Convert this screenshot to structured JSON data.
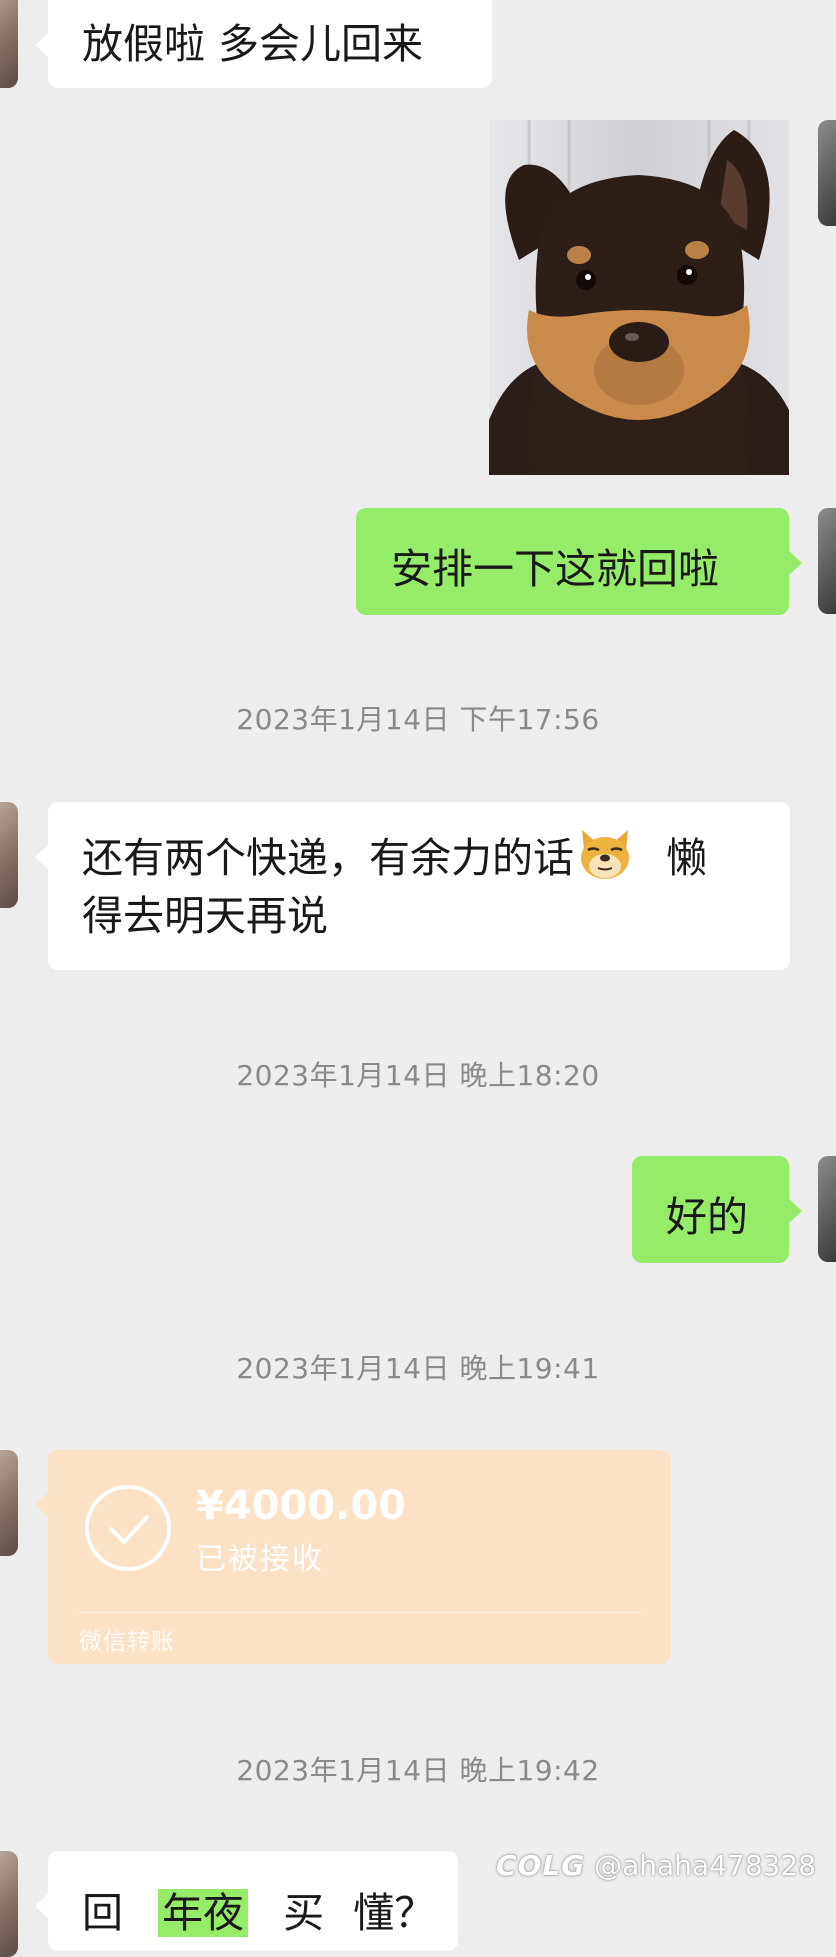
{
  "messages": {
    "m1": {
      "text": "放假啦 多会儿回来"
    },
    "m2": {
      "image": "dog-photo"
    },
    "m3": {
      "text": "安排一下这就回啦"
    },
    "ts1": "2023年1月14日 下午17:56",
    "m4": {
      "text_part1": "还有两个快递，有余力的话",
      "emoji": "doge-emoji",
      "text_part2": "懒",
      "text_line2": "得去明天再说"
    },
    "ts2": "2023年1月14日 晚上18:20",
    "m5": {
      "text": "好的"
    },
    "ts3": "2023年1月14日 晚上19:41",
    "transfer": {
      "amount": "¥4000.00",
      "status": "已被接收",
      "label": "微信转账"
    },
    "ts4": "2023年1月14日 晚上19:42",
    "m6": {
      "part1": "回",
      "highlight": "年夜",
      "part2": "买",
      "part3": "懂？"
    }
  },
  "watermark": {
    "logo": "COLG",
    "handle": "@ahaha478328"
  },
  "colors": {
    "background": "#ededed",
    "bubble_sent": "#95ec69",
    "bubble_received": "#ffffff",
    "transfer_card": "#fbe1c5",
    "timestamp_text": "#8a8a8a"
  }
}
